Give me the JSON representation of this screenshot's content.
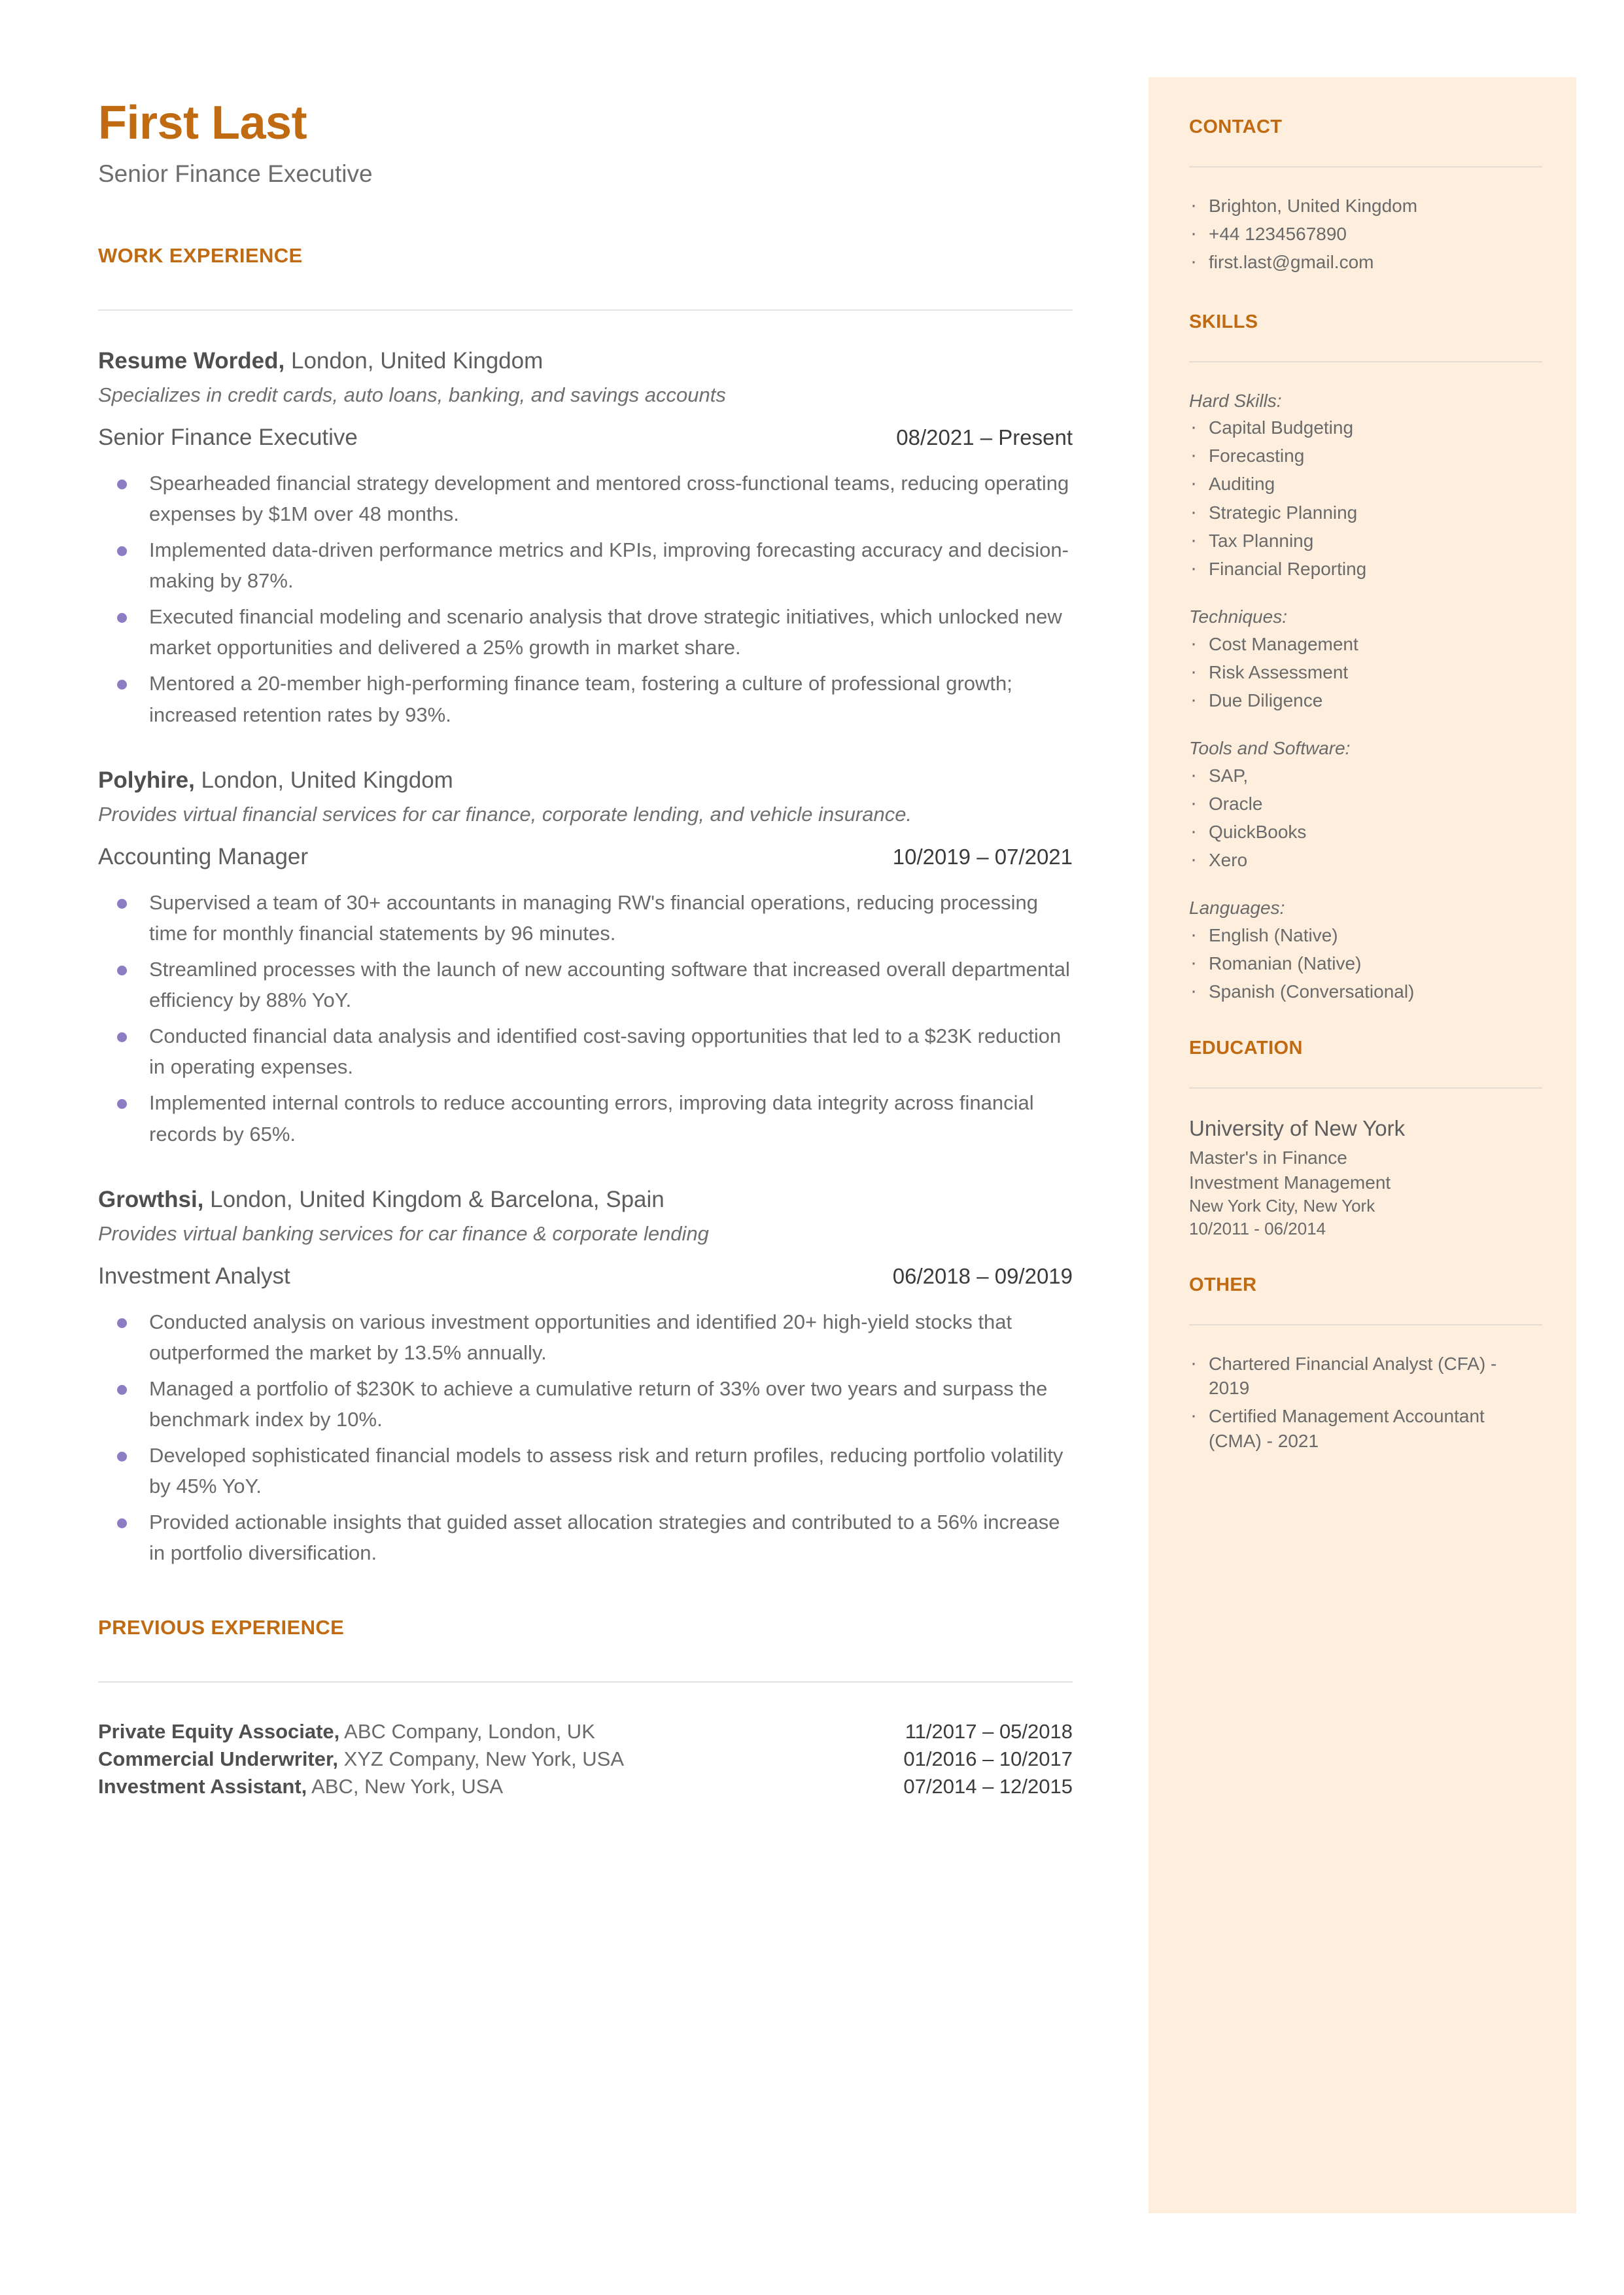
{
  "theme": {
    "accent": "#c06a12",
    "sidebar_bg": "#fdeedd",
    "bullet": "#8b7cc4",
    "body_text": "#6a6a6a"
  },
  "header": {
    "name": "First Last",
    "headline": "Senior Finance Executive"
  },
  "work_experience": {
    "section_label": "WORK EXPERIENCE",
    "jobs": [
      {
        "company": "Resume Worded,",
        "location": " London, United Kingdom",
        "description": "Specializes in credit cards, auto loans, banking, and savings accounts",
        "title": "Senior Finance Executive",
        "dates": "08/2021 – Present",
        "bullets": [
          "Spearheaded financial strategy development and mentored cross-functional teams, reducing operating expenses by $1M over 48 months.",
          "Implemented data-driven performance metrics and KPIs, improving forecasting accuracy and decision-making by 87%.",
          "Executed financial modeling and scenario analysis that drove strategic initiatives, which unlocked new market opportunities and delivered a 25% growth in market share.",
          "Mentored a 20-member high-performing finance team, fostering a culture of professional growth; increased retention rates by 93%."
        ]
      },
      {
        "company": "Polyhire,",
        "location": " London, United Kingdom",
        "description": "Provides virtual financial services for car finance, corporate lending, and vehicle insurance.",
        "title": "Accounting Manager",
        "dates": "10/2019 – 07/2021",
        "bullets": [
          "Supervised a team of 30+ accountants in managing RW's financial operations, reducing processing time for monthly financial statements by 96 minutes.",
          "Streamlined processes with the launch of new accounting software that increased overall departmental efficiency by 88% YoY.",
          "Conducted financial data analysis and identified cost-saving opportunities that led to a $23K reduction in operating expenses.",
          "Implemented internal controls to reduce accounting errors, improving data integrity across financial records by 65%."
        ]
      },
      {
        "company": "Growthsi,",
        "location": " London, United Kingdom & Barcelona, Spain",
        "description": "Provides virtual banking services for car finance & corporate lending",
        "title": "Investment Analyst",
        "dates": "06/2018 – 09/2019",
        "bullets": [
          "Conducted analysis on various investment opportunities and identified 20+ high-yield stocks that outperformed the market by 13.5% annually.",
          "Managed a portfolio of $230K to achieve a cumulative return of 33% over two years and surpass the benchmark index by 10%.",
          "Developed sophisticated financial models to assess risk and return profiles, reducing portfolio volatility by 45% YoY.",
          "Provided actionable insights that guided asset allocation strategies and contributed to a 56% increase in portfolio diversification."
        ]
      }
    ]
  },
  "previous_experience": {
    "section_label": "PREVIOUS EXPERIENCE",
    "rows": [
      {
        "title": "Private Equity Associate,",
        "detail": " ABC Company, London, UK",
        "dates": "11/2017 – 05/2018"
      },
      {
        "title": "Commercial Underwriter,",
        "detail": " XYZ Company, New York, USA",
        "dates": "01/2016 – 10/2017"
      },
      {
        "title": "Investment Assistant,",
        "detail": " ABC, New York, USA",
        "dates": "07/2014 – 12/2015"
      }
    ]
  },
  "sidebar": {
    "contact": {
      "label": "CONTACT",
      "items": [
        " Brighton, United Kingdom",
        "+44 1234567890",
        "first.last@gmail.com"
      ]
    },
    "skills": {
      "label": "SKILLS",
      "groups": [
        {
          "label": "Hard Skills:",
          "items": [
            "Capital Budgeting",
            "Forecasting",
            "Auditing",
            "Strategic Planning",
            "Tax Planning",
            "Financial Reporting"
          ]
        },
        {
          "label": "Techniques:",
          "items": [
            "Cost Management",
            "Risk Assessment",
            "Due Diligence"
          ]
        },
        {
          "label": "Tools and Software:",
          "items": [
            "SAP,",
            "Oracle",
            "QuickBooks",
            "Xero"
          ]
        },
        {
          "label": "Languages:",
          "items": [
            "English (Native)",
            "Romanian (Native)",
            "Spanish (Conversational)"
          ]
        }
      ]
    },
    "education": {
      "label": "EDUCATION",
      "school": "University of New York",
      "degree": "Master's in Finance",
      "focus": "Investment Management",
      "location": "New York City, New York",
      "dates": "10/2011 - 06/2014"
    },
    "other": {
      "label": "OTHER",
      "items": [
        " Chartered Financial Analyst (CFA) - 2019",
        " Certified Management Accountant (CMA) - 2021"
      ]
    }
  }
}
